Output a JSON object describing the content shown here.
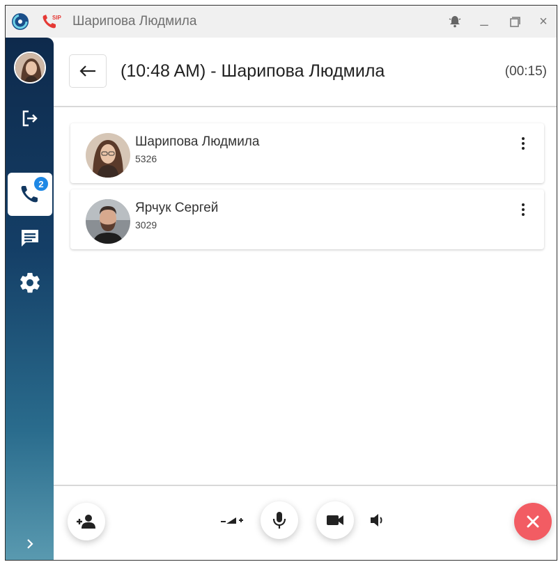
{
  "window": {
    "title": "Шарипова Людмила",
    "sip_label": "SIP",
    "minimize_label": "_",
    "close_label": "×"
  },
  "sidebar": {
    "calls_badge": "2"
  },
  "header": {
    "title": "(10:48 AM) - Шарипова Людмила",
    "timer": "(00:15)"
  },
  "participants": [
    {
      "name": "Шарипова Людмила",
      "extension": "5326"
    },
    {
      "name": "Ярчук Сергей",
      "extension": "3029"
    }
  ],
  "colors": {
    "accent": "#1e88e5",
    "hangup": "#f25c63",
    "sidebar_top": "#0e2a4c",
    "sidebar_bottom": "#5a9ab0"
  },
  "icons": [
    "app-logo-icon",
    "sip-phone-icon",
    "bell-icon",
    "maximize-icon",
    "logout-icon",
    "phone-icon",
    "chat-icon",
    "settings-icon",
    "chevron-right-icon",
    "back-arrow-icon",
    "more-vert-icon",
    "add-person-icon",
    "volume-low-icon",
    "mic-icon",
    "video-icon",
    "volume-icon",
    "close-icon"
  ]
}
